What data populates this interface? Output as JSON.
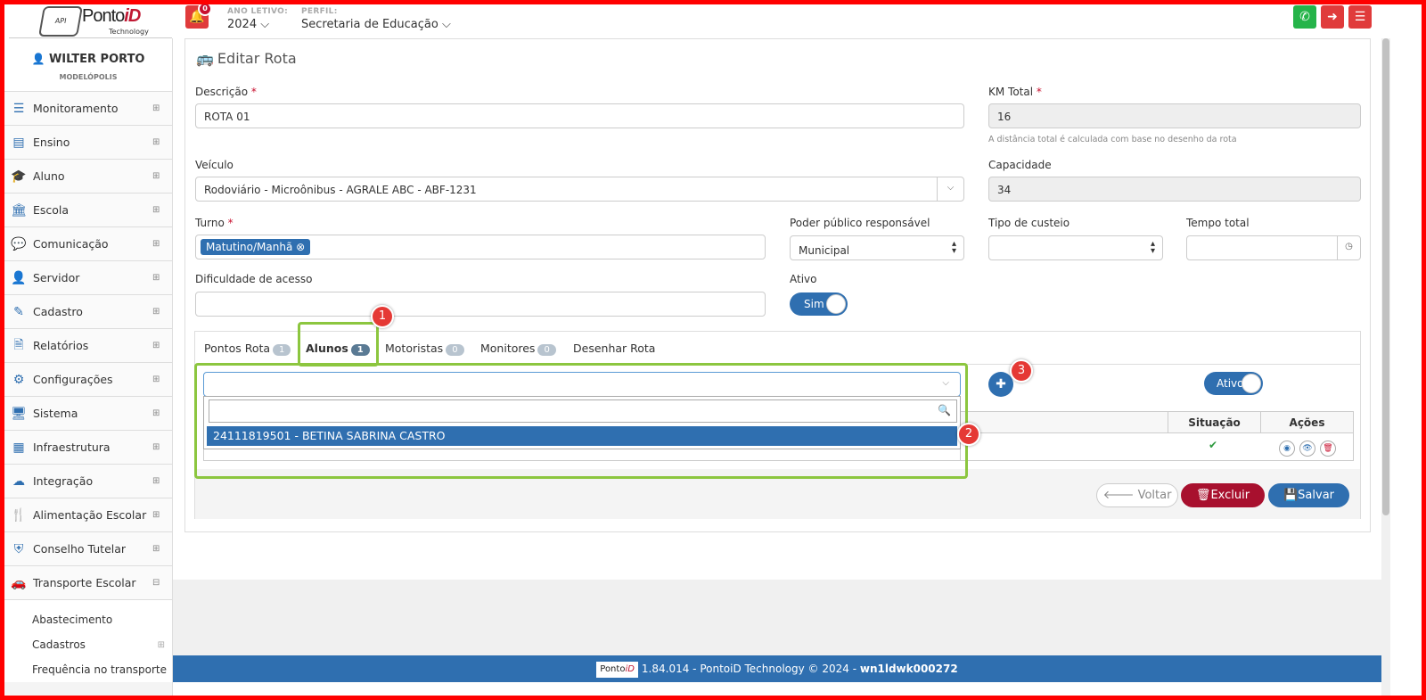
{
  "header": {
    "logo_api": "API",
    "logo_name_a": "Ponto",
    "logo_name_b": "iD",
    "logo_sub": "Technology",
    "notifications": "0",
    "ano_label": "ANO LETIVO:",
    "ano_value": "2024 ⌵",
    "perfil_label": "PERFIL:",
    "perfil_value": "Secretaria de Educação ⌵"
  },
  "colors": {
    "accent": "#2f6fb0",
    "danger": "#a8102e",
    "whatsapp": "#25b44a",
    "marker": "#e53935",
    "highlight": "#8cc63f"
  },
  "user": {
    "name": "WILTER PORTO",
    "city": "MODELÓPOLIS"
  },
  "sidebar": {
    "items": [
      {
        "label": "Monitoramento",
        "icon": "sliders-icon",
        "glyph": "☰"
      },
      {
        "label": "Ensino",
        "icon": "book-icon",
        "glyph": "▤"
      },
      {
        "label": "Aluno",
        "icon": "graduation-cap-icon",
        "glyph": "🎓"
      },
      {
        "label": "Escola",
        "icon": "institution-icon",
        "glyph": "🏛"
      },
      {
        "label": "Comunicação",
        "icon": "chat-bubble-icon",
        "glyph": "💬"
      },
      {
        "label": "Servidor",
        "icon": "user-icon",
        "glyph": "👤"
      },
      {
        "label": "Cadastro",
        "icon": "edit-icon",
        "glyph": "✎"
      },
      {
        "label": "Relatórios",
        "icon": "file-icon",
        "glyph": "🗎"
      },
      {
        "label": "Configurações",
        "icon": "gear-icon",
        "glyph": "⚙"
      },
      {
        "label": "Sistema",
        "icon": "monitor-icon",
        "glyph": "🖥"
      },
      {
        "label": "Infraestrutura",
        "icon": "building-icon",
        "glyph": "▦"
      },
      {
        "label": "Integração",
        "icon": "cloud-icon",
        "glyph": "☁"
      },
      {
        "label": "Alimentação Escolar",
        "icon": "cutlery-icon",
        "glyph": "🍴"
      },
      {
        "label": "Conselho Tutelar",
        "icon": "shield-icon",
        "glyph": "⛨"
      },
      {
        "label": "Transporte Escolar",
        "icon": "car-icon",
        "glyph": "🚗"
      }
    ],
    "subitems": [
      {
        "label": "Abastecimento"
      },
      {
        "label": "Cadastros"
      },
      {
        "label": "Frequência no transporte"
      }
    ]
  },
  "form": {
    "title": "Editar Rota",
    "descricao_label": "Descrição",
    "descricao_value": "ROTA 01",
    "km_label": "KM Total",
    "km_value": "16",
    "km_hint": "A distância total é calculada com base no desenho da rota",
    "veiculo_label": "Veículo",
    "veiculo_value": "Rodoviário - Microônibus - AGRALE ABC - ABF-1231",
    "capacidade_label": "Capacidade",
    "capacidade_value": "34",
    "turno_label": "Turno",
    "turno_tag": "Matutino/Manhã",
    "poder_label": "Poder público responsável",
    "poder_value": "Municipal",
    "custeio_label": "Tipo de custeio",
    "tempo_label": "Tempo total",
    "dificuldade_label": "Dificuldade de acesso",
    "ativo_label": "Ativo",
    "ativo_value": "Sim",
    "required_mark": "*"
  },
  "tabs": [
    {
      "label": "Pontos Rota",
      "count": "1"
    },
    {
      "label": "Alunos",
      "count": "1"
    },
    {
      "label": "Motoristas",
      "count": "0"
    },
    {
      "label": "Monitores",
      "count": "0"
    },
    {
      "label": "Desenhar Rota"
    }
  ],
  "alunos": {
    "option": "24111819501 - BETINA SABRINA CASTRO",
    "ativos_toggle": "Ativos",
    "col_situacao": "Situação",
    "col_acoes": "Ações"
  },
  "markers": [
    "1",
    "2",
    "3"
  ],
  "buttons": {
    "voltar": "Voltar",
    "excluir": "Excluir",
    "salvar": "Salvar"
  },
  "footer": {
    "logo_a": "Ponto",
    "logo_b": "iD",
    "text": "1.84.014 - PontoiD Technology © 2024 - ",
    "host": "wn1ldwk000272"
  }
}
